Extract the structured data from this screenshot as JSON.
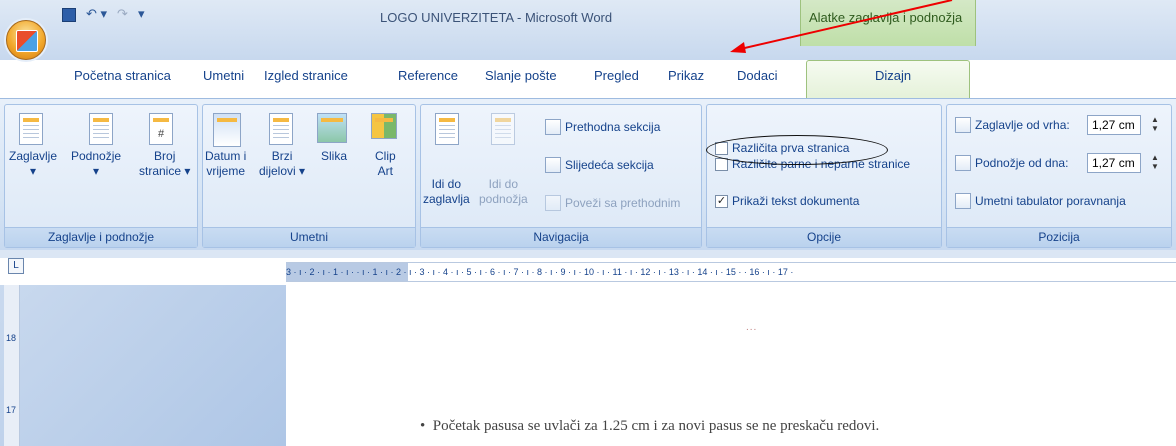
{
  "window": {
    "title": "LOGO UNIVERZITETA - Microsoft Word"
  },
  "context_header": "Alatke zaglavlja i podnožja",
  "quick_access": {
    "icons": [
      "save-icon",
      "undo-icon",
      "redo-icon",
      "customize-icon"
    ]
  },
  "tabs": [
    "Početna stranica",
    "Umetni",
    "Izgled stranice",
    "Reference",
    "Slanje pošte",
    "Pregled",
    "Prikaz",
    "Dodaci"
  ],
  "active_tab": "Dizajn",
  "groups": {
    "header_footer": {
      "label": "Zaglavlje i podnožje",
      "btn1": "Zaglavlje",
      "btn2": "Podnožje",
      "btn3a": "Broj",
      "btn3b": "stranice"
    },
    "insert": {
      "label": "Umetni",
      "btn1a": "Datum i",
      "btn1b": "vrijeme",
      "btn2a": "Brzi",
      "btn2b": "dijelovi",
      "btn3": "Slika",
      "btn4a": "Clip",
      "btn4b": "Art"
    },
    "navigation": {
      "label": "Navigacija",
      "btn1a": "Idi do",
      "btn1b": "zaglavlja",
      "btn2a": "Idi do",
      "btn2b": "podnožja",
      "prev": "Prethodna sekcija",
      "next": "Slijedeća sekcija",
      "link": "Poveži sa prethodnim"
    },
    "options": {
      "label": "Opcije",
      "opt1": "Različita prva stranica",
      "opt2": "Različite parne i neparne stranice",
      "opt3": "Prikaži tekst dokumenta",
      "opt3_checked": "✓"
    },
    "position": {
      "label": "Pozicija",
      "header_label": "Zaglavlje od vrha:",
      "header_value": "1,27 cm",
      "footer_label": "Podnožje od dna:",
      "footer_value": "1,27 cm",
      "tab_label": "Umetni tabulator poravnanja"
    }
  },
  "ruler": {
    "corner": "L",
    "text": "3 · ı · 2 · ı · 1 · ı ·  · ı · 1 · ı · 2 · ı · 3 · ı · 4 · ı · 5 · ı · 6 · ı · 7 · ı · 8 · ı · 9 · ı · 10 · ı · 11 · ı · 12 · ı · 13 · ı · 14 · ı · 15 ·  · 16 · ı · 17 ·",
    "v1": "18",
    "v2": "17"
  },
  "document": {
    "header_marker": "...",
    "bullet": "•",
    "text": "Početak pasusa se uvlači za 1.25 cm i za novi pasus se ne preskaču redovi."
  }
}
